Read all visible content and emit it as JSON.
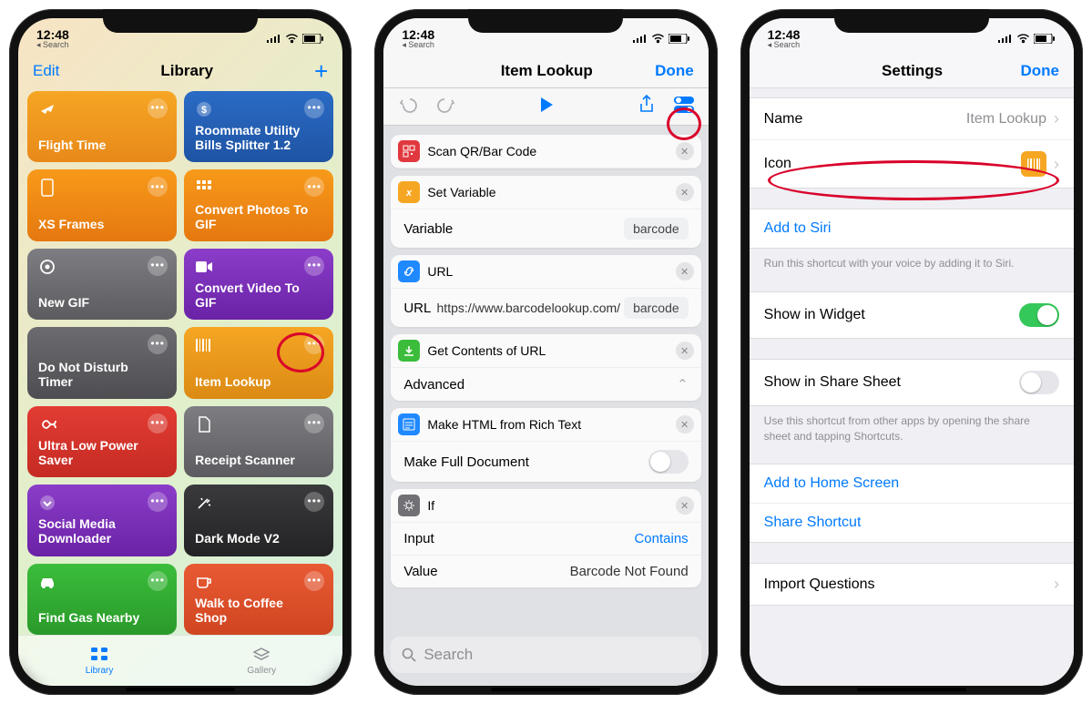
{
  "status": {
    "time": "12:48",
    "back": "◂ Search"
  },
  "s1": {
    "edit": "Edit",
    "title": "Library",
    "add": "+",
    "tabs": {
      "library": "Library",
      "gallery": "Gallery"
    },
    "tiles": [
      {
        "label": "Flight Time",
        "icon": "plane",
        "bg": "linear-gradient(#f5a623,#e8891a)"
      },
      {
        "label": "Roommate Utility Bills Splitter 1.2",
        "icon": "dollar",
        "bg": "linear-gradient(#2a6bc5,#1f54a3)"
      },
      {
        "label": "XS Frames",
        "icon": "phone",
        "bg": "linear-gradient(#f79a1a,#e57810)"
      },
      {
        "label": "Convert Photos To GIF",
        "icon": "grid3",
        "bg": "linear-gradient(#f79a1a,#e57810)"
      },
      {
        "label": "New GIF",
        "icon": "target",
        "bg": "linear-gradient(#7d7d82,#5c5c60)"
      },
      {
        "label": "Convert Video To GIF",
        "icon": "video",
        "bg": "linear-gradient(#8b3dc9,#6a22a6)"
      },
      {
        "label": "Do Not Disturb Timer",
        "icon": "moon",
        "bg": "linear-gradient(#6b6b70,#4e4e52)"
      },
      {
        "label": "Item Lookup",
        "icon": "barcode",
        "bg": "linear-gradient(#f5a623,#db8a14)"
      },
      {
        "label": "Ultra Low Power Saver",
        "icon": "infinity",
        "bg": "linear-gradient(#e23c33,#c52b23)"
      },
      {
        "label": "Receipt Scanner",
        "icon": "doc",
        "bg": "linear-gradient(#7d7d82,#5c5c60)"
      },
      {
        "label": "Social Media Downloader",
        "icon": "chevdown",
        "bg": "linear-gradient(#8b3dc9,#6a22a6)"
      },
      {
        "label": "Dark Mode V2",
        "icon": "wand",
        "bg": "linear-gradient(#3a3a3c,#232325)"
      },
      {
        "label": "Find Gas Nearby",
        "icon": "car",
        "bg": "linear-gradient(#3bbd3b,#2a9a2a)"
      },
      {
        "label": "Walk to Coffee Shop",
        "icon": "coffee",
        "bg": "linear-gradient(#e85a33,#d04521)"
      }
    ]
  },
  "s2": {
    "title": "Item Lookup",
    "done": "Done",
    "actions": [
      {
        "icon": "#e0383e",
        "glyph": "qr",
        "title": "Scan QR/Bar Code"
      },
      {
        "icon": "#f5a623",
        "glyph": "x",
        "title": "Set Variable",
        "rows": [
          {
            "k": "Variable",
            "pill": "barcode"
          }
        ]
      },
      {
        "icon": "#1f89ff",
        "glyph": "link",
        "title": "URL",
        "rows": [
          {
            "k": "URL",
            "url": "https://www.barcodelookup.com/",
            "pill": "barcode"
          }
        ]
      },
      {
        "icon": "#3bbd3b",
        "glyph": "dl",
        "title": "Get Contents of URL",
        "rows": [
          {
            "k": "Advanced",
            "expand": true
          }
        ]
      },
      {
        "icon": "#1f89ff",
        "glyph": "html",
        "title": "Make HTML from Rich Text",
        "rows": [
          {
            "k": "Make Full Document",
            "toggle": false
          }
        ]
      },
      {
        "icon": "#707075",
        "glyph": "gear",
        "title": "If",
        "rows": [
          {
            "k": "Input",
            "contains": "Contains"
          },
          {
            "k": "Value",
            "v": "Barcode Not Found"
          }
        ]
      }
    ],
    "search": "Search"
  },
  "s3": {
    "title": "Settings",
    "done": "Done",
    "name_label": "Name",
    "name_val": "Item Lookup",
    "icon_label": "Icon",
    "siri": "Add to Siri",
    "siri_note": "Run this shortcut with your voice by adding it to Siri.",
    "widget": "Show in Widget",
    "sheet": "Show in Share Sheet",
    "sheet_note": "Use this shortcut from other apps by opening the share sheet and tapping Shortcuts.",
    "home": "Add to Home Screen",
    "share": "Share Shortcut",
    "importq": "Import Questions"
  }
}
